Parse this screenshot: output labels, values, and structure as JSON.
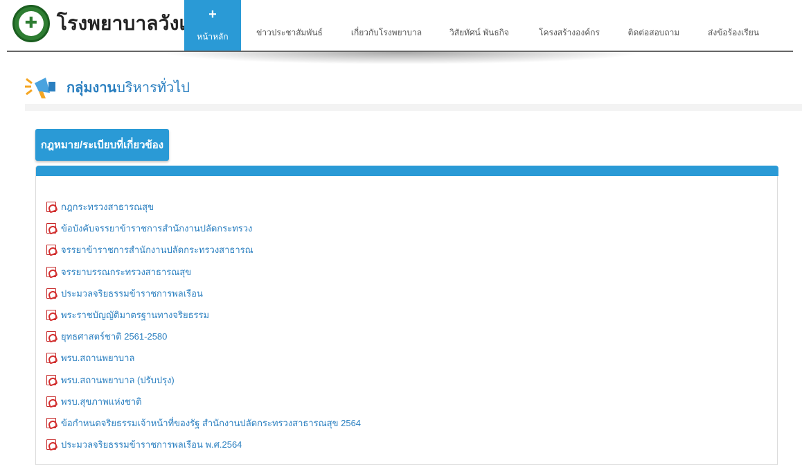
{
  "header": {
    "site_title": "โรงพยาบาลวังเจ้า",
    "logo_icon": "ministry-of-public-health-seal-icon"
  },
  "nav": {
    "items": [
      {
        "label": "หน้าหลัก",
        "icon": "plus-icon",
        "active": true
      },
      {
        "label": "ข่าวประชาสัมพันธ์"
      },
      {
        "label": "เกี่ยวกับโรงพยาบาล"
      },
      {
        "label": "วิสัยทัศน์ พันธกิจ"
      },
      {
        "label": "โครงสร้างองค์กร"
      },
      {
        "label": "ติดต่อสอบถาม"
      },
      {
        "label": "ส่งข้อร้องเรียน"
      }
    ]
  },
  "section": {
    "title_strong": "กลุ่มงาน",
    "title_rest": "บริหารทั่วไป",
    "icon": "megaphone-icon"
  },
  "tab": {
    "label": "กฎหมาย/ระเบียบที่เกี่ยวข้อง"
  },
  "documents": [
    "กฎกระทรวงสาธารณสุข",
    "ข้อบังคับจรรยาข้าราชการสำนักงานปลัดกระทรวง",
    "จรรยาข้าราชการสำนักงานปลัดกระทรวงสาธารณ",
    "จรรยาบรรณกระทรวงสาธารณสุข",
    "ประมวลจริยธรรมข้าราชการพลเรือน",
    "พระราชบัญญัติมาตรฐานทางจริยธรรม",
    "ยุทธศาสตร์ชาติ 2561-2580",
    "พรบ.สถานพยาบาล",
    "พรบ.สถานพยาบาล (ปรับปรุง)",
    "พรบ.สุขภาพแห่งชาติ",
    "ข้อกำหนดจริยธรรมเจ้าหน้าที่ของรัฐ สำนักงานปลัดกระทรวงสาธารณสุข 2564",
    "ประมวลจริยธรรมข้าราชการพลเรือน พ.ศ.2564"
  ],
  "colors": {
    "accent": "#2a9ad6",
    "link": "#2a7fc0",
    "pdf_red": "#d32f2f"
  }
}
